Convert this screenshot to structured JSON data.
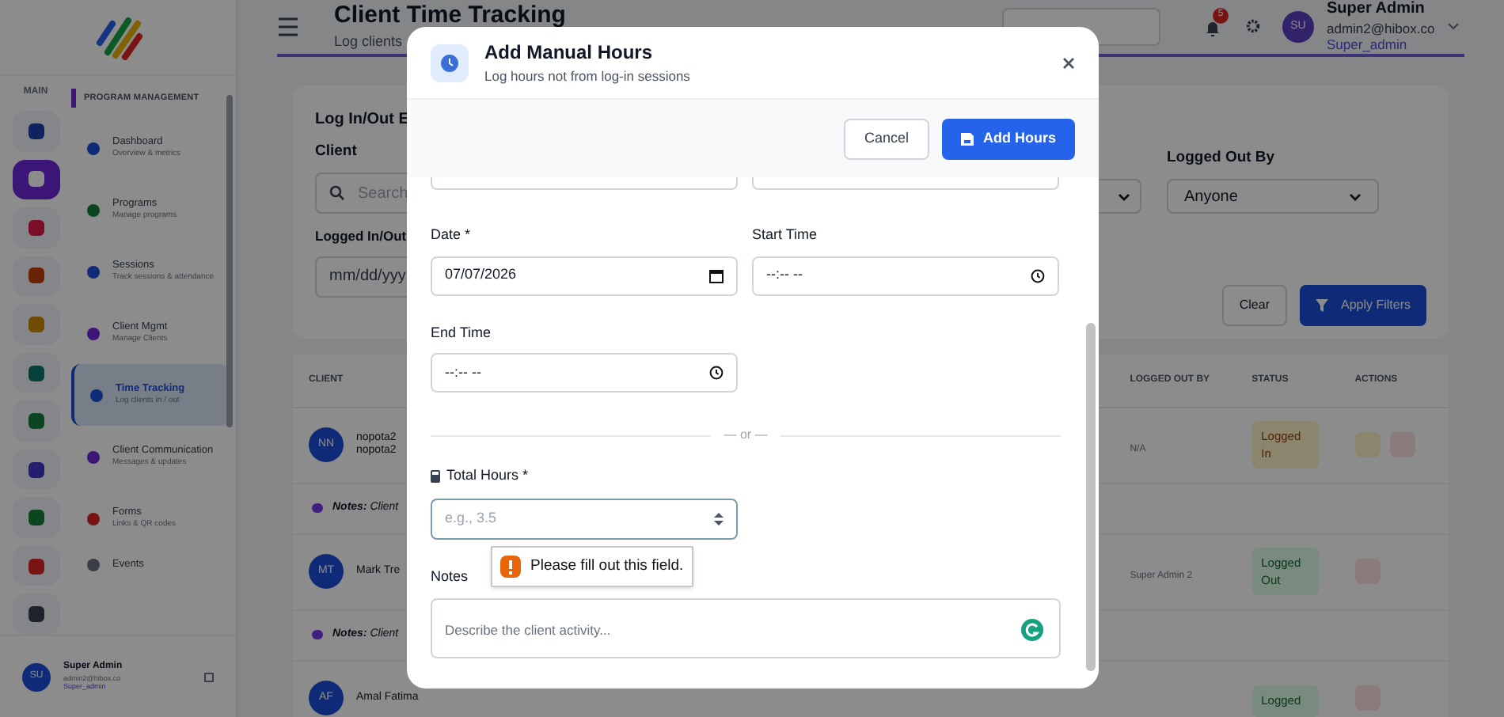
{
  "rail": {
    "label": "MAIN",
    "items": [
      {
        "selected": false
      },
      {
        "selected": true
      },
      {
        "selected": false
      },
      {
        "selected": false
      },
      {
        "selected": false
      },
      {
        "selected": false
      },
      {
        "selected": false
      },
      {
        "selected": false
      },
      {
        "selected": false
      },
      {
        "selected": false
      },
      {
        "selected": false
      }
    ]
  },
  "sidebar": {
    "section": "PROGRAM MANAGEMENT",
    "items": [
      {
        "title": "Dashboard",
        "subtitle": "Overview & metrics",
        "selected": false
      },
      {
        "title": "Programs",
        "subtitle": "Manage programs",
        "selected": false
      },
      {
        "title": "Sessions",
        "subtitle": "Track sessions & attendance",
        "selected": false
      },
      {
        "title": "Client Mgmt",
        "subtitle": "Manage Clients",
        "selected": false
      },
      {
        "title": "Time Tracking",
        "subtitle": "Log clients in / out",
        "selected": true
      },
      {
        "title": "Client Communication",
        "subtitle": "Messages & updates",
        "selected": false
      },
      {
        "title": "Forms",
        "subtitle": "Links & QR codes",
        "selected": false
      },
      {
        "title": "Events",
        "selected": false
      }
    ],
    "user": {
      "initials": "SU",
      "name": "Super Admin",
      "email": "admin2@hibox.co",
      "role": "Super_admin"
    }
  },
  "header": {
    "title": "Client Time Tracking",
    "subtitle": "Log clients",
    "notifications": "5",
    "user": {
      "initials": "SU",
      "name": "Super Admin",
      "email": "admin2@hibox.co",
      "role": "Super_admin"
    }
  },
  "filters": {
    "title": "Log In/Out E",
    "client_label": "Client",
    "client_placeholder": "Search",
    "date_label": "Logged In/Out",
    "date_placeholder": "mm/dd/yyy",
    "logged_out_by_label": "Logged Out By",
    "logged_out_by_value": "Anyone",
    "clear": "Clear",
    "apply": "Apply Filters"
  },
  "table": {
    "columns": [
      "CLIENT",
      "LOGGED OUT BY",
      "STATUS",
      "ACTIONS"
    ],
    "rows": [
      {
        "initials": "NN",
        "name": "nopota2",
        "email": "nopota2",
        "logged_out_by": "N/A",
        "status": "Logged In",
        "kind": "in",
        "notes": "**Notes:** Client"
      },
      {
        "initials": "MT",
        "name": "Mark Tre",
        "logged_out_by": "Super Admin 2",
        "status": "Logged Out",
        "kind": "out",
        "notes": "**Notes:** Client"
      },
      {
        "initials": "AF",
        "name": "Amal Fatima",
        "status": "Logged",
        "kind": "out"
      }
    ]
  },
  "modal": {
    "title": "Add Manual Hours",
    "subtitle": "Log hours not from log-in sessions",
    "cancel": "Cancel",
    "submit": "Add Hours",
    "date_label": "Date *",
    "date_value": "07/07/2026",
    "start_label": "Start Time",
    "start_value": "--:-- --",
    "end_label": "End Time",
    "end_value": "--:-- --",
    "or": "— or —",
    "total_label": "Total Hours *",
    "total_placeholder": "e.g., 3.5",
    "validation": "Please fill out this field.",
    "notes_label": "Notes",
    "notes_placeholder": "Describe the client activity..."
  }
}
